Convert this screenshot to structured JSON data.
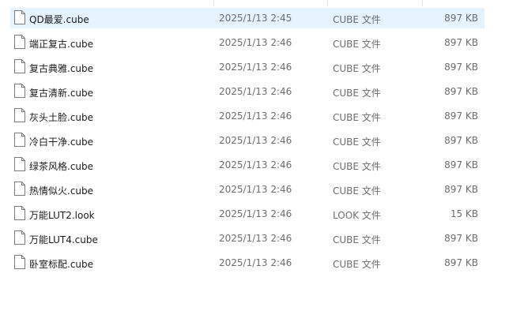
{
  "colors": {
    "selected_row": "#e5f3ff",
    "secondary_text": "#6d6d6d"
  },
  "files": [
    {
      "name": "QD最爱.cube",
      "date": "2025/1/13 2:45",
      "type": "CUBE 文件",
      "size": "897 KB",
      "icon": "file-icon",
      "selected": true
    },
    {
      "name": "端正复古.cube",
      "date": "2025/1/13 2:46",
      "type": "CUBE 文件",
      "size": "897 KB",
      "icon": "file-icon"
    },
    {
      "name": "复古典雅.cube",
      "date": "2025/1/13 2:46",
      "type": "CUBE 文件",
      "size": "897 KB",
      "icon": "file-icon"
    },
    {
      "name": "复古清新.cube",
      "date": "2025/1/13 2:46",
      "type": "CUBE 文件",
      "size": "897 KB",
      "icon": "file-icon"
    },
    {
      "name": "灰头土脸.cube",
      "date": "2025/1/13 2:46",
      "type": "CUBE 文件",
      "size": "897 KB",
      "icon": "file-icon"
    },
    {
      "name": "冷白干净.cube",
      "date": "2025/1/13 2:46",
      "type": "CUBE 文件",
      "size": "897 KB",
      "icon": "file-icon"
    },
    {
      "name": "绿茶风格.cube",
      "date": "2025/1/13 2:46",
      "type": "CUBE 文件",
      "size": "897 KB",
      "icon": "file-icon"
    },
    {
      "name": "热情似火.cube",
      "date": "2025/1/13 2:46",
      "type": "CUBE 文件",
      "size": "897 KB",
      "icon": "file-icon"
    },
    {
      "name": "万能LUT2.look",
      "date": "2025/1/13 2:46",
      "type": "LOOK 文件",
      "size": "15 KB",
      "icon": "file-icon"
    },
    {
      "name": "万能LUT4.cube",
      "date": "2025/1/13 2:46",
      "type": "CUBE 文件",
      "size": "897 KB",
      "icon": "file-icon"
    },
    {
      "name": "卧室标配.cube",
      "date": "2025/1/13 2:46",
      "type": "CUBE 文件",
      "size": "897 KB",
      "icon": "file-icon"
    }
  ]
}
